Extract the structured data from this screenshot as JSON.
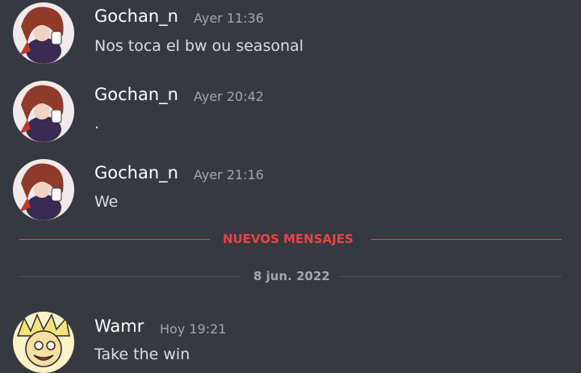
{
  "messages": [
    {
      "username": "Gochan_n",
      "time": "Ayer 11:36",
      "text": "Nos toca el bw ou seasonal",
      "avatar": "gochan-avatar"
    },
    {
      "username": "Gochan_n",
      "time": "Ayer 20:42",
      "text": ".",
      "avatar": "gochan-avatar"
    },
    {
      "username": "Gochan_n",
      "time": "Ayer 21:16",
      "text": "We",
      "avatar": "gochan-avatar"
    },
    {
      "username": "Wamr",
      "time": "Hoy 19:21",
      "text": "Take the win",
      "avatar": "wamr-avatar"
    }
  ],
  "new_messages_divider": {
    "label": "NUEVOS MENSAJES",
    "color": "#ed4245"
  },
  "date_divider": {
    "label": "8 jun. 2022",
    "color": "#a3a6aa"
  },
  "colors": {
    "background": "#36393f",
    "username": "#ffffff",
    "text": "#dcddde",
    "timestamp": "#a3a6aa"
  }
}
